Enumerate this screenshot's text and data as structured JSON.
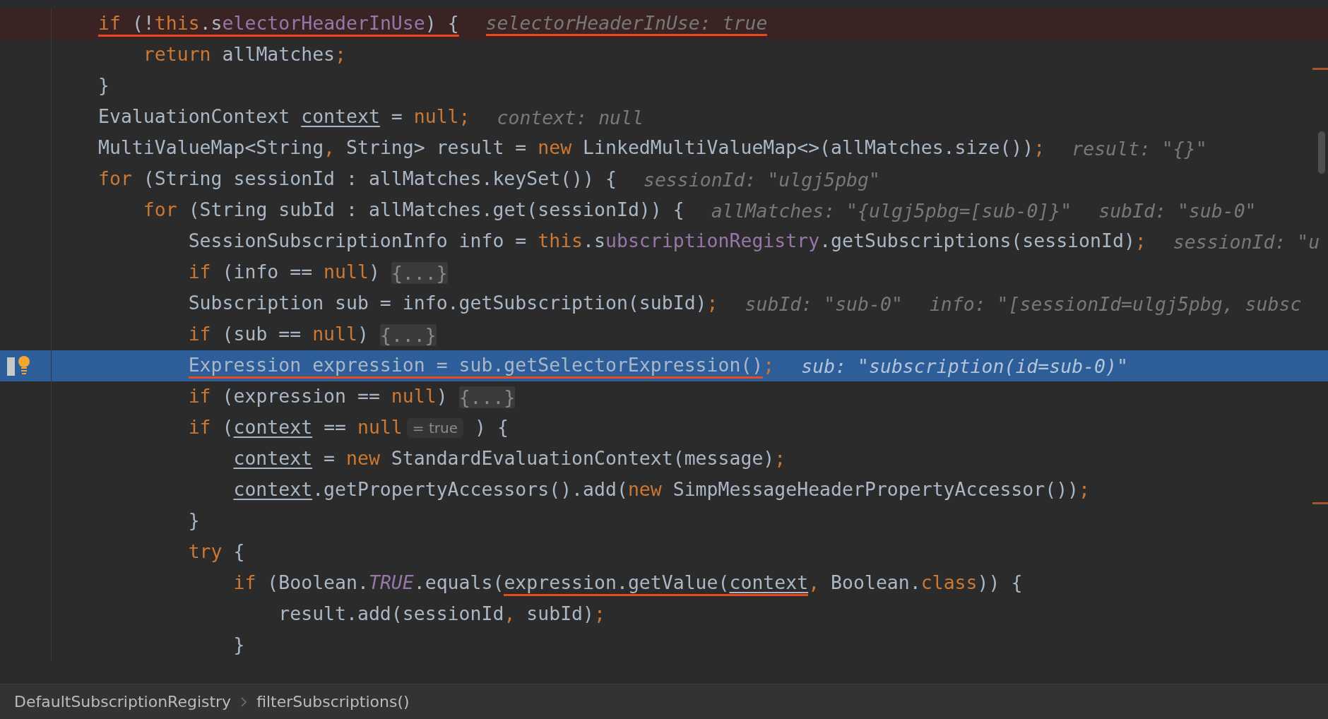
{
  "editor": {
    "lines": [
      {
        "breakpoint": true,
        "current": false,
        "segments": [
          {
            "kind": "keyword",
            "text": "if",
            "marked": true
          },
          {
            "kind": "plain",
            "text": " (!",
            "marked": true
          },
          {
            "kind": "keyword",
            "text": "this",
            "marked": true
          },
          {
            "kind": "field",
            "text": ".selectorHeaderInUse",
            "marked": true
          },
          {
            "kind": "plain",
            "text": ") {",
            "marked": true
          },
          {
            "kind": "hint",
            "text": "selectorHeaderInUse: true",
            "marked": true
          }
        ]
      },
      {
        "breakpoint": false,
        "current": false,
        "segments": [
          {
            "kind": "keyword",
            "text": "    return"
          },
          {
            "kind": "plain",
            "text": " allMatches"
          },
          {
            "kind": "keyword",
            "text": ";"
          }
        ]
      },
      {
        "breakpoint": false,
        "current": false,
        "segments": [
          {
            "kind": "plain",
            "text": "}"
          }
        ]
      },
      {
        "breakpoint": false,
        "current": false,
        "segments": [
          {
            "kind": "plain",
            "text": "EvaluationContext "
          },
          {
            "kind": "local",
            "text": "context"
          },
          {
            "kind": "plain",
            "text": " = "
          },
          {
            "kind": "keyword",
            "text": "null"
          },
          {
            "kind": "keyword",
            "text": ";"
          },
          {
            "kind": "hint",
            "text": "context: null"
          }
        ]
      },
      {
        "breakpoint": false,
        "current": false,
        "segments": [
          {
            "kind": "plain",
            "text": "MultiValueMap<String"
          },
          {
            "kind": "keyword",
            "text": ","
          },
          {
            "kind": "plain",
            "text": " String> result = "
          },
          {
            "kind": "keyword",
            "text": "new"
          },
          {
            "kind": "plain",
            "text": " LinkedMultiValueMap<>(allMatches.size())"
          },
          {
            "kind": "keyword",
            "text": ";"
          },
          {
            "kind": "hint",
            "text": "result: \"{}\""
          }
        ]
      },
      {
        "breakpoint": false,
        "current": false,
        "segments": [
          {
            "kind": "keyword",
            "text": "for"
          },
          {
            "kind": "plain",
            "text": " (String sessionId : allMatches.keySet()) {"
          },
          {
            "kind": "hint",
            "text": "sessionId: \"ulgj5pbg\""
          }
        ]
      },
      {
        "breakpoint": false,
        "current": false,
        "segments": [
          {
            "kind": "keyword",
            "text": "    for"
          },
          {
            "kind": "plain",
            "text": " (String subId : allMatches.get(sessionId)) {"
          },
          {
            "kind": "hint",
            "text": "allMatches: \"{ulgj5pbg=[sub-0]}\""
          },
          {
            "kind": "hint",
            "text": "subId: \"sub-0\""
          }
        ]
      },
      {
        "breakpoint": false,
        "current": false,
        "segments": [
          {
            "kind": "plain",
            "text": "        SessionSubscriptionInfo info = "
          },
          {
            "kind": "keyword",
            "text": "this"
          },
          {
            "kind": "field",
            "text": ".subscriptionRegistry"
          },
          {
            "kind": "plain",
            "text": ".getSubscriptions(sessionId)"
          },
          {
            "kind": "keyword",
            "text": ";"
          },
          {
            "kind": "hint",
            "text": "sessionId: \"u"
          }
        ]
      },
      {
        "breakpoint": false,
        "current": false,
        "segments": [
          {
            "kind": "keyword",
            "text": "        if"
          },
          {
            "kind": "plain",
            "text": " (info == "
          },
          {
            "kind": "keyword",
            "text": "null"
          },
          {
            "kind": "plain",
            "text": ")"
          },
          {
            "kind": "fold",
            "text": "{...}"
          }
        ]
      },
      {
        "breakpoint": false,
        "current": false,
        "segments": [
          {
            "kind": "plain",
            "text": "        Subscription sub = info.getSubscription(subId)"
          },
          {
            "kind": "keyword",
            "text": ";"
          },
          {
            "kind": "hint",
            "text": "subId: \"sub-0\""
          },
          {
            "kind": "hint",
            "text": "info: \"[sessionId=ulgj5pbg, subsc"
          }
        ]
      },
      {
        "breakpoint": false,
        "current": false,
        "segments": [
          {
            "kind": "keyword",
            "text": "        if"
          },
          {
            "kind": "plain",
            "text": " (sub == "
          },
          {
            "kind": "keyword",
            "text": "null"
          },
          {
            "kind": "plain",
            "text": ")"
          },
          {
            "kind": "fold",
            "text": "{...}"
          }
        ]
      },
      {
        "breakpoint": false,
        "current": true,
        "segments": [
          {
            "kind": "plain",
            "text": "        Expression expression = sub.getSelectorExpression()",
            "marked": true
          },
          {
            "kind": "keyword",
            "text": ";"
          },
          {
            "kind": "hint",
            "text": "sub: \"subscription(id=sub-0)\""
          }
        ]
      },
      {
        "breakpoint": false,
        "current": false,
        "segments": [
          {
            "kind": "keyword",
            "text": "        if"
          },
          {
            "kind": "plain",
            "text": " (expression == "
          },
          {
            "kind": "keyword",
            "text": "null"
          },
          {
            "kind": "plain",
            "text": ")"
          },
          {
            "kind": "fold",
            "text": "{...}"
          }
        ]
      },
      {
        "breakpoint": false,
        "current": false,
        "segments": [
          {
            "kind": "keyword",
            "text": "        if"
          },
          {
            "kind": "plain",
            "text": " ("
          },
          {
            "kind": "local",
            "text": "context"
          },
          {
            "kind": "plain",
            "text": " == "
          },
          {
            "kind": "keyword",
            "text": "null"
          },
          {
            "kind": "value",
            "text": "= true"
          },
          {
            "kind": "plain",
            "text": " ) {"
          }
        ]
      },
      {
        "breakpoint": false,
        "current": false,
        "segments": [
          {
            "kind": "local",
            "text": "            context"
          },
          {
            "kind": "plain",
            "text": " = "
          },
          {
            "kind": "keyword",
            "text": "new"
          },
          {
            "kind": "plain",
            "text": " StandardEvaluationContext(message)"
          },
          {
            "kind": "keyword",
            "text": ";"
          }
        ]
      },
      {
        "breakpoint": false,
        "current": false,
        "segments": [
          {
            "kind": "local",
            "text": "            context"
          },
          {
            "kind": "plain",
            "text": ".getPropertyAccessors().add("
          },
          {
            "kind": "keyword",
            "text": "new"
          },
          {
            "kind": "plain",
            "text": " SimpMessageHeaderPropertyAccessor())"
          },
          {
            "kind": "keyword",
            "text": ";"
          }
        ]
      },
      {
        "breakpoint": false,
        "current": false,
        "segments": [
          {
            "kind": "plain",
            "text": "        }"
          }
        ]
      },
      {
        "breakpoint": false,
        "current": false,
        "segments": [
          {
            "kind": "keyword",
            "text": "        try"
          },
          {
            "kind": "plain",
            "text": " {"
          }
        ]
      },
      {
        "breakpoint": false,
        "current": false,
        "segments": [
          {
            "kind": "keyword",
            "text": "            if"
          },
          {
            "kind": "plain",
            "text": " (Boolean."
          },
          {
            "kind": "static",
            "text": "TRUE"
          },
          {
            "kind": "plain",
            "text": ".equals("
          },
          {
            "kind": "plain",
            "text": "expression.getValue(",
            "marked": true
          },
          {
            "kind": "local",
            "text": "context",
            "marked": true
          },
          {
            "kind": "keyword",
            "text": ","
          },
          {
            "kind": "plain",
            "text": " Boolean."
          },
          {
            "kind": "keyword",
            "text": "class"
          },
          {
            "kind": "plain",
            "text": ")) {"
          }
        ]
      },
      {
        "breakpoint": false,
        "current": false,
        "segments": [
          {
            "kind": "plain",
            "text": "                result.add(sessionId"
          },
          {
            "kind": "keyword",
            "text": ","
          },
          {
            "kind": "plain",
            "text": " subId)"
          },
          {
            "kind": "keyword",
            "text": ";"
          }
        ]
      },
      {
        "breakpoint": false,
        "current": false,
        "segments": [
          {
            "kind": "plain",
            "text": "            }"
          }
        ]
      }
    ]
  },
  "breadcrumbs": [
    "DefaultSubscriptionRegistry",
    "filterSubscriptions()"
  ]
}
